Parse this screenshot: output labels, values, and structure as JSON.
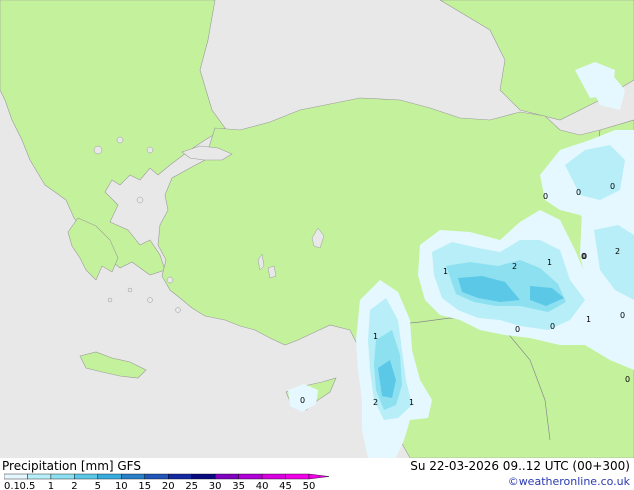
{
  "footer": {
    "title": "Precipitation [mm]  GFS",
    "datetime": "Su 22-03-2026 09..12 UTC (00+300)",
    "copyright": "©weatheronline.co.uk"
  },
  "legend": {
    "labels": [
      "0.1",
      "0.5",
      "1",
      "2",
      "5",
      "10",
      "15",
      "20",
      "25",
      "30",
      "35",
      "40",
      "45",
      "50"
    ],
    "colors": [
      "#e6f8ff",
      "#b7eef8",
      "#8de0f0",
      "#5cc8e8",
      "#39acde",
      "#2a80c8",
      "#1f56b8",
      "#1428a0",
      "#0a0a80",
      "#8000c0",
      "#b000d8",
      "#d800e0",
      "#f000e8"
    ]
  },
  "map": {
    "land_color": "#c4f29c",
    "sea_color": "#e8e8e8",
    "contour_labels": [
      {
        "text": "1",
        "name": "contour-label-east-1"
      },
      {
        "text": "2",
        "name": "contour-label-east-2"
      },
      {
        "text": "1",
        "name": "contour-label-east-3"
      },
      {
        "text": "0",
        "name": "contour-label-east-4"
      },
      {
        "text": "0",
        "name": "contour-label-east-5"
      },
      {
        "text": "0",
        "name": "contour-label-east-6"
      },
      {
        "text": "1",
        "name": "contour-label-levant-1"
      },
      {
        "text": "2",
        "name": "contour-label-levant-2"
      },
      {
        "text": "1",
        "name": "contour-label-levant-3"
      },
      {
        "text": "0",
        "name": "contour-label-cyprus"
      },
      {
        "text": "0",
        "name": "contour-label-caucasus-1"
      },
      {
        "text": "0",
        "name": "contour-label-caucasus-2"
      },
      {
        "text": "0",
        "name": "contour-label-caucasus-3"
      },
      {
        "text": "2",
        "name": "contour-label-iran-1"
      },
      {
        "text": "0",
        "name": "contour-label-iran-2"
      },
      {
        "text": "0",
        "name": "contour-label-iran-3"
      },
      {
        "text": "1",
        "name": "contour-label-iran-4"
      },
      {
        "text": "0",
        "name": "contour-label-iran-5"
      }
    ]
  }
}
